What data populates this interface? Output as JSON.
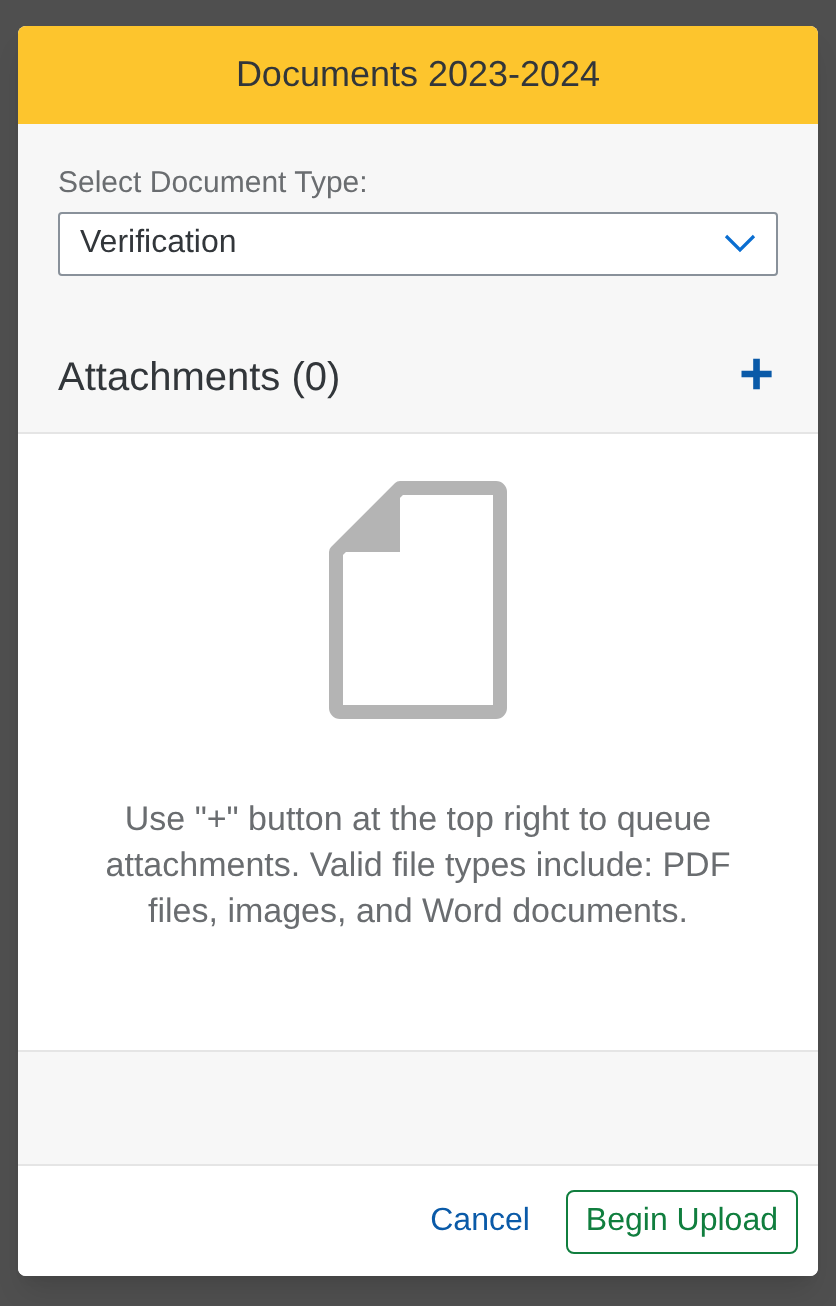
{
  "dialog": {
    "title": "Documents 2023-2024",
    "select": {
      "label": "Select Document Type:",
      "value": "Verification"
    },
    "attachments": {
      "title": "Attachments (0)",
      "add_button": "+",
      "empty_message": "Use \"+\" button at the top right to queue attachments. Valid file types include: PDF files, images, and Word documents."
    },
    "buttons": [
      {
        "label": "Cancel",
        "kind": "link"
      },
      {
        "label": "Begin Upload",
        "kind": "outlined"
      }
    ]
  }
}
